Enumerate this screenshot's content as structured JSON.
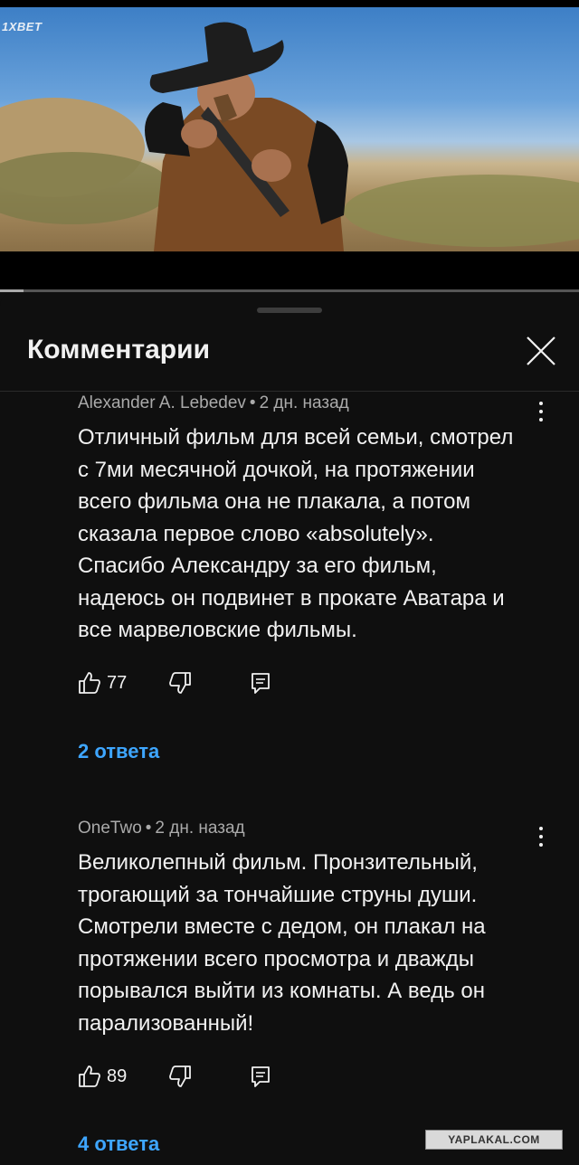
{
  "video": {
    "logo_text": "1XBET",
    "progress_fraction": 0.04
  },
  "comments_panel": {
    "title": "Комментарии",
    "comments": [
      {
        "author": "Alexander A. Lebedev",
        "time": "2 дн. назад",
        "lines": [
          "Отличный фильм для всей семьи, смотрел",
          "с 7ми месячной дочкой, на протяжении",
          "всего фильма она не плакала, а потом",
          "сказала первое слово «absolutely».",
          "Спасибо Александру за его фильм,",
          "надеюсь он подвинет в прокате Аватара и",
          "все марвеловские фильмы."
        ],
        "likes": "77",
        "replies_label": "2 ответа"
      },
      {
        "author": "OneTwo",
        "time": "2 дн. назад",
        "lines": [
          "Великолепный фильм. Пронзительный,",
          "трогающий за тончайшие струны души.",
          "Смотрели вместе с дедом, он плакал на",
          "протяжении всего просмотра и дважды",
          "порывался выйти из комнаты. А ведь он",
          "парализованный!"
        ],
        "likes": "89",
        "replies_label": "4 ответа"
      }
    ]
  },
  "watermark": "YAPLAKAL.COM",
  "icons": {
    "like": "thumbs-up-icon",
    "dislike": "thumbs-down-icon",
    "reply": "reply-comment-icon",
    "more": "more-vertical-icon",
    "close": "close-icon"
  },
  "colors": {
    "background": "#0f0f0f",
    "text": "#f1f1f1",
    "meta": "#aaaaaa",
    "link": "#3ea6ff"
  }
}
